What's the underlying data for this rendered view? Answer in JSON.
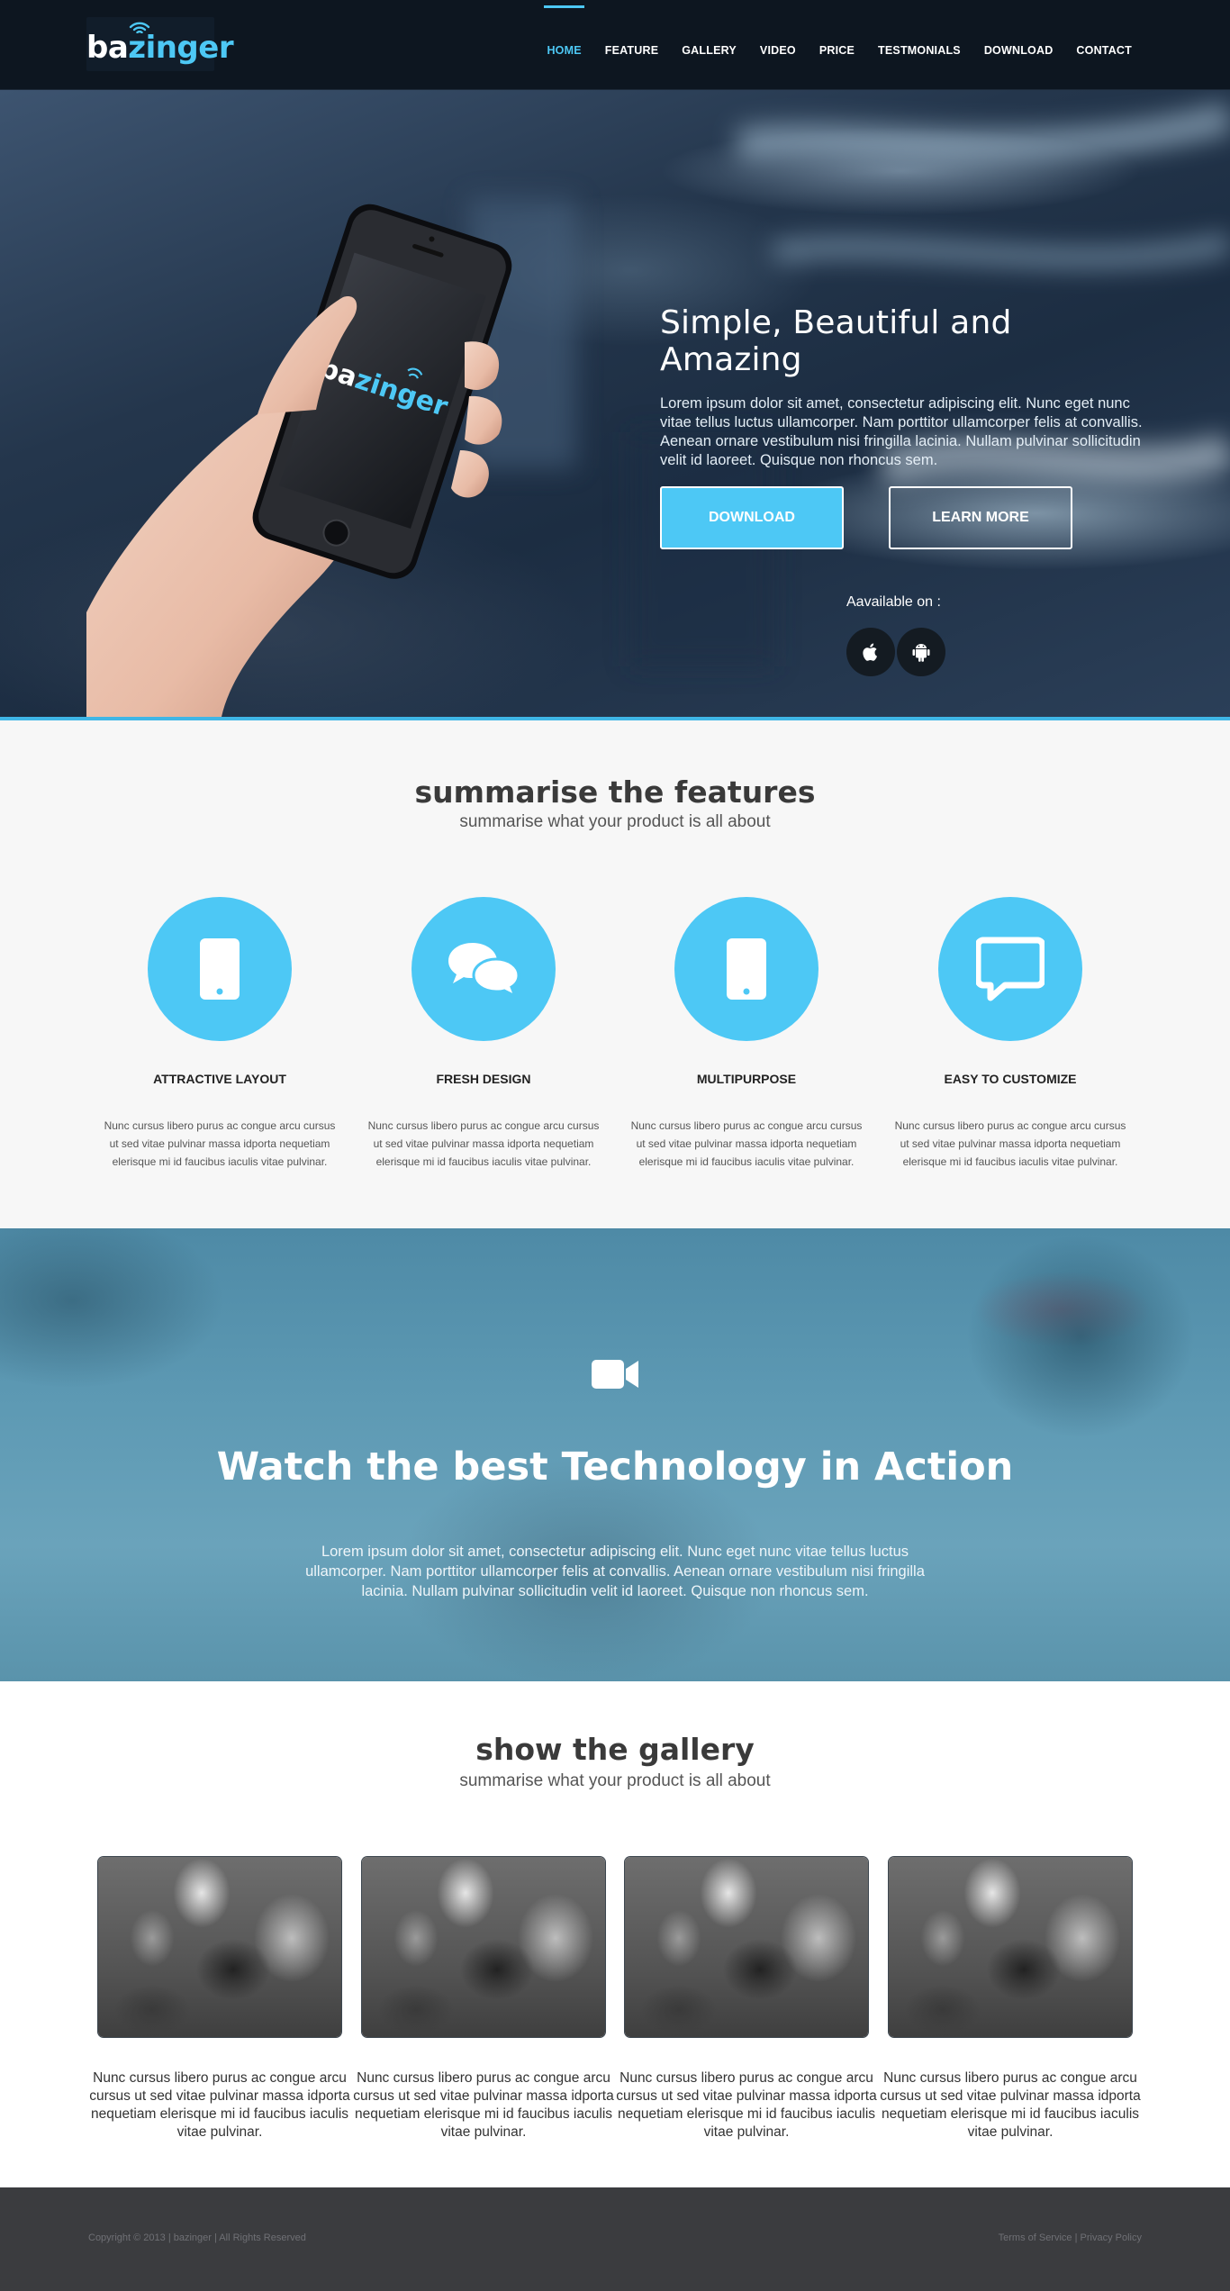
{
  "brand": {
    "logo_part1": "ba",
    "logo_part2": "zinger"
  },
  "nav": {
    "items": [
      {
        "label": "HOME",
        "active": true
      },
      {
        "label": "FEATURE"
      },
      {
        "label": "GALLERY"
      },
      {
        "label": "VIDEO"
      },
      {
        "label": "PRICE"
      },
      {
        "label": "TESTMONIALS"
      },
      {
        "label": "DOWNLOAD"
      },
      {
        "label": "CONTACT"
      }
    ]
  },
  "hero": {
    "title": "Simple, Beautiful and Amazing",
    "text": "Lorem ipsum dolor sit amet, consectetur adipiscing elit. Nunc eget nunc vitae tellus luctus ullamcorper. Nam porttitor ullamcorper felis at convallis. Aenean ornare vestibulum nisi fringilla lacinia. Nullam pulvinar sollicitudin velit id laoreet. Quisque non rhoncus sem.",
    "download_label": "DOWNLOAD",
    "learn_more_label": "LEARN MORE",
    "available_label": "Aavailable on :",
    "stores": [
      "apple-icon",
      "android-icon"
    ]
  },
  "features": {
    "title": "summarise the features",
    "subtitle": "summarise what your product is all about",
    "items": [
      {
        "icon": "smartphone-icon",
        "title": "ATTRACTIVE LAYOUT",
        "text": "Nunc cursus libero purus ac congue arcu cursus ut sed vitae pulvinar massa idporta nequetiam elerisque mi id faucibus iaculis vitae pulvinar."
      },
      {
        "icon": "chat-bubbles-icon",
        "title": "FRESH DESIGN",
        "text": "Nunc cursus libero purus ac congue arcu cursus ut sed vitae pulvinar massa idporta nequetiam elerisque mi id faucibus iaculis vitae pulvinar."
      },
      {
        "icon": "smartphone-icon",
        "title": "MULTIPURPOSE",
        "text": "Nunc cursus libero purus ac congue arcu cursus ut sed vitae pulvinar massa idporta nequetiam elerisque mi id faucibus iaculis vitae pulvinar."
      },
      {
        "icon": "message-icon",
        "title": "EASY TO CUSTOMIZE",
        "text": "Nunc cursus libero purus ac congue arcu cursus ut sed vitae pulvinar massa idporta nequetiam elerisque mi id faucibus iaculis vitae pulvinar."
      }
    ]
  },
  "video": {
    "icon": "video-camera-icon",
    "title": "Watch the best Technology in Action",
    "text": "Lorem ipsum dolor sit amet, consectetur adipiscing elit. Nunc eget nunc vitae tellus luctus ullamcorper. Nam porttitor ullamcorper felis at convallis. Aenean ornare vestibulum nisi fringilla lacinia. Nullam pulvinar sollicitudin velit id laoreet. Quisque non rhoncus sem."
  },
  "gallery": {
    "title": "show the gallery",
    "subtitle": "summarise what your product is all about",
    "items": [
      {
        "caption": "Nunc cursus libero purus ac congue arcu cursus ut sed vitae pulvinar massa idporta nequetiam elerisque mi id faucibus iaculis vitae pulvinar."
      },
      {
        "caption": "Nunc cursus libero purus ac congue arcu cursus ut sed vitae pulvinar massa idporta nequetiam elerisque mi id faucibus iaculis vitae pulvinar."
      },
      {
        "caption": "Nunc cursus libero purus ac congue arcu cursus ut sed vitae pulvinar massa idporta nequetiam elerisque mi id faucibus iaculis vitae pulvinar."
      },
      {
        "caption": "Nunc cursus libero purus ac congue arcu cursus ut sed vitae pulvinar massa idporta nequetiam elerisque mi id faucibus iaculis vitae pulvinar."
      }
    ]
  },
  "footer": {
    "copyright": "Copyright © 2013 | bazinger | All Rights Reserved",
    "terms": "Terms of Service",
    "separator": "|",
    "privacy": "Privacy Policy"
  },
  "colors": {
    "accent": "#4dc8f5",
    "navbar": "#0d1620",
    "footer": "#3b3c3f",
    "features_bg": "#f7f7f7"
  }
}
